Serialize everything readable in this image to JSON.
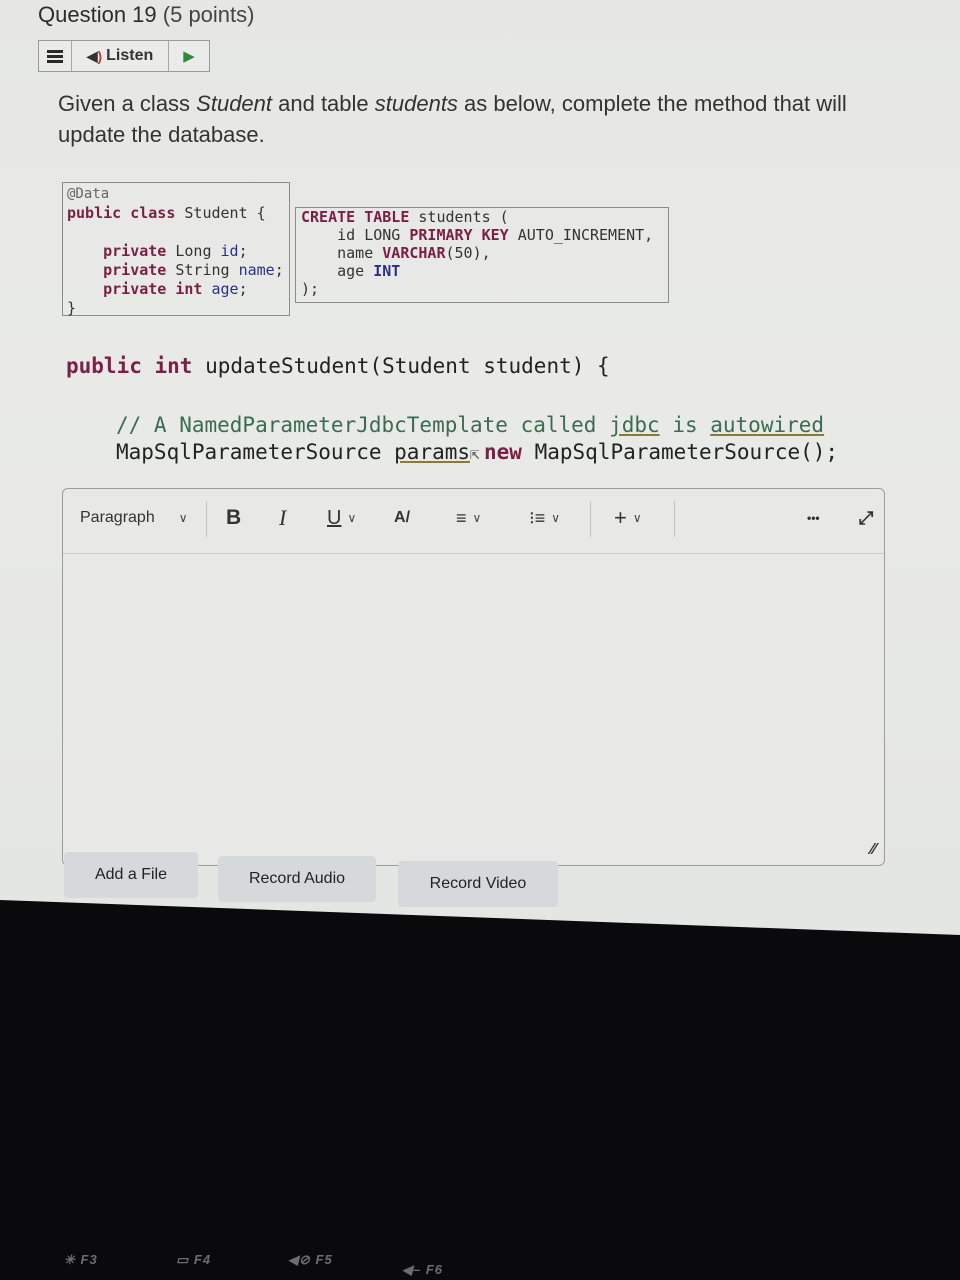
{
  "question": {
    "title": "Question 19",
    "points": "(5 points)"
  },
  "listen_bar": {
    "menu_icon": "hamburger-icon",
    "listen_label": "Listen",
    "speaker_icon": "speaker-icon",
    "play_icon": "play-icon"
  },
  "prompt": {
    "part1": "Given a class ",
    "class_name": "Student",
    "part2": " and table ",
    "table_name": "students",
    "part3": " as below, complete the method that will update the database."
  },
  "class_code": {
    "annotation": "@Data",
    "decl_kw": "public class",
    "decl_name": " Student {",
    "fields": [
      {
        "mod": "private",
        "type": " Long ",
        "name": "id",
        "end": ";"
      },
      {
        "mod": "private",
        "type": " String ",
        "name": "name",
        "end": ";"
      },
      {
        "mod": "private",
        "type": " int ",
        "name": "age",
        "end": ";"
      }
    ],
    "close": "}"
  },
  "sql_code": {
    "line1_kw": "CREATE TABLE",
    "line1_rest": " students (",
    "line2_a": "    id LONG ",
    "line2_kw": "PRIMARY KEY",
    "line2_b": " AUTO_INCREMENT,",
    "line3_a": "    name ",
    "line3_kw": "VARCHAR",
    "line3_b": "(50),",
    "line4_a": "    age ",
    "line4_kw": "INT",
    "close": ");"
  },
  "method": {
    "kw": "public int",
    "signature": " updateStudent(Student student) {",
    "comment_a": "// A NamedParameterJdbcTemplate called ",
    "comment_jdbc": "jdbc",
    "comment_b": " is ",
    "comment_autowired": "autowired",
    "line2_a": "MapSqlParameterSource ",
    "line2_params": "params",
    "line2_eq": " = ",
    "line2_new": "new",
    "line2_b": " MapSqlParameterSource();"
  },
  "editor": {
    "block_format": "Paragraph",
    "bold_label": "B",
    "italic_label": "I",
    "underline_label": "U",
    "text_color_label": "A",
    "insert_label": "+",
    "more_label": "•••",
    "content": ""
  },
  "actions": {
    "add_file": "Add a File",
    "record_audio": "Record Audio",
    "record_video": "Record Video"
  },
  "keyboard": {
    "keys": [
      "F3",
      "F4",
      "F5",
      "F6"
    ]
  }
}
